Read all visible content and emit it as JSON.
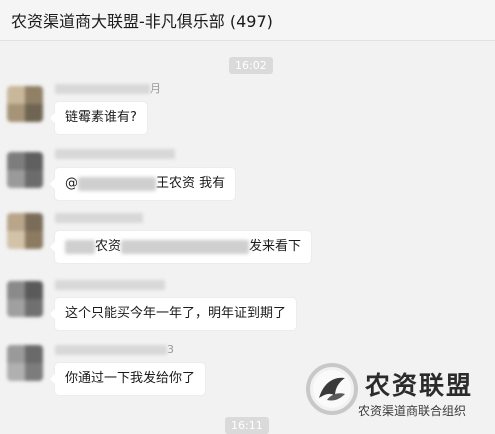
{
  "window": {
    "title": "农资渠道商大联盟-非凡俱乐部 (497)"
  },
  "timestamps": {
    "first": "16:02",
    "second": "16:11"
  },
  "messages": [
    {
      "sender_visible": "月",
      "text": "链霉素谁有?",
      "avatar_colors": [
        "#c9b79a",
        "#8f8066",
        "#a69478",
        "#6f6552"
      ]
    },
    {
      "sender_visible": "",
      "text_prefix": "@",
      "text_suffix": "王农资 我有",
      "avatar_colors": [
        "#7d7d7d",
        "#5f5f5f",
        "#9a9a9a",
        "#6c6c6c"
      ]
    },
    {
      "sender_visible": "",
      "text_prefix": "农资",
      "text_suffix": "发来看下",
      "avatar_colors": [
        "#b8a58a",
        "#7a6c58",
        "#d2c3a8",
        "#8c7b62"
      ]
    },
    {
      "sender_visible": "",
      "text": "这个只能买今年一年了，明年证到期了",
      "avatar_colors": [
        "#8a8a8a",
        "#5a5a5a",
        "#a0a0a0",
        "#707070"
      ]
    },
    {
      "sender_visible": "3",
      "text": "你通过一下我发给你了",
      "avatar_colors": [
        "#9a9a9a",
        "#6a6a6a",
        "#b0b0b0",
        "#7c7c7c"
      ]
    }
  ],
  "watermark": {
    "name": "农资联盟",
    "subtitle": "农资渠道商联合组织"
  },
  "colors": {
    "background": "#f2f2f2",
    "bubble": "#ffffff",
    "timestamp_bg": "#dadada"
  }
}
